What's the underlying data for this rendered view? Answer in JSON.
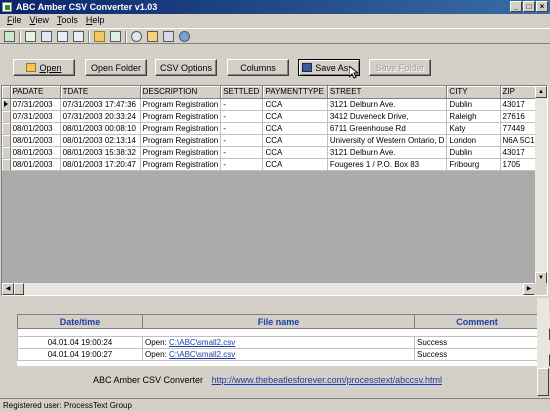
{
  "window": {
    "title": "ABC Amber CSV Converter v1.03",
    "controls": {
      "minimize": "_",
      "maximize": "□",
      "close": "×"
    }
  },
  "menu": [
    {
      "key": "F",
      "rest": "ile"
    },
    {
      "key": "V",
      "rest": "iew"
    },
    {
      "key": "T",
      "rest": "ools"
    },
    {
      "key": "H",
      "rest": "elp"
    }
  ],
  "buttons": {
    "open": "Open",
    "open_folder": "Open Folder",
    "csv_options": "CSV Options",
    "columns": "Columns",
    "save_as": "Save As...",
    "save_folder": "Save Folder"
  },
  "grid": {
    "columns": [
      "PADATE",
      "TDATE",
      "DESCRIPTION",
      "SETTLED",
      "PAYMENTTYPE",
      "STREET",
      "CITY",
      "ZIP"
    ],
    "rows": [
      [
        "07/31/2003",
        "07/31/2003 17:47:36",
        "Program Registration",
        "-",
        "CCA",
        "3121 Delburn Ave.",
        "Dublin",
        "43017"
      ],
      [
        "07/31/2003",
        "07/31/2003 20:33:24",
        "Program Registration",
        "-",
        "CCA",
        "3412 Duveneck Drive,",
        "Raleigh",
        "27616"
      ],
      [
        "08/01/2003",
        "08/01/2003 00:08:10",
        "Program Registration",
        "-",
        "CCA",
        "6711 Greenhouse Rd",
        "Katy",
        "77449"
      ],
      [
        "08/01/2003",
        "08/01/2003 02:13:14",
        "Program Registration",
        "-",
        "CCA",
        "University of Western Ontario, D",
        "London",
        "N6A 5C1"
      ],
      [
        "08/01/2003",
        "08/01/2003 15:38:32",
        "Program Registration",
        "-",
        "CCA",
        "3121 Delburn Ave.",
        "Dublin",
        "43017"
      ],
      [
        "08/01/2003",
        "08/01/2003 17:20:47",
        "Program Registration",
        "-",
        "CCA",
        "Fougeres 1 / P.O. Box 83",
        "Fribourg",
        "1705"
      ]
    ]
  },
  "log": {
    "headers": [
      "Date/time",
      "File name",
      "Comment"
    ],
    "rows": [
      {
        "datetime": "04.01.04 19:00:24",
        "prefix": "Open:",
        "file": "C:\\ABC\\small2.csv",
        "comment": "Success"
      },
      {
        "datetime": "04.01.04 19:00:27",
        "prefix": "Open:",
        "file": "C:\\ABC\\small2.csv",
        "comment": "Success"
      }
    ]
  },
  "footer": {
    "app_name": "ABC Amber CSV Converter",
    "url": "http://www.thebeatlesforever.com/processtext/abccsv.html"
  },
  "status": "Registered user: ProcessText Group",
  "colors": {
    "title_start": "#0a246a",
    "title_end": "#3a6ea5",
    "link": "#1a3ea8",
    "face": "#d4d0c8"
  }
}
